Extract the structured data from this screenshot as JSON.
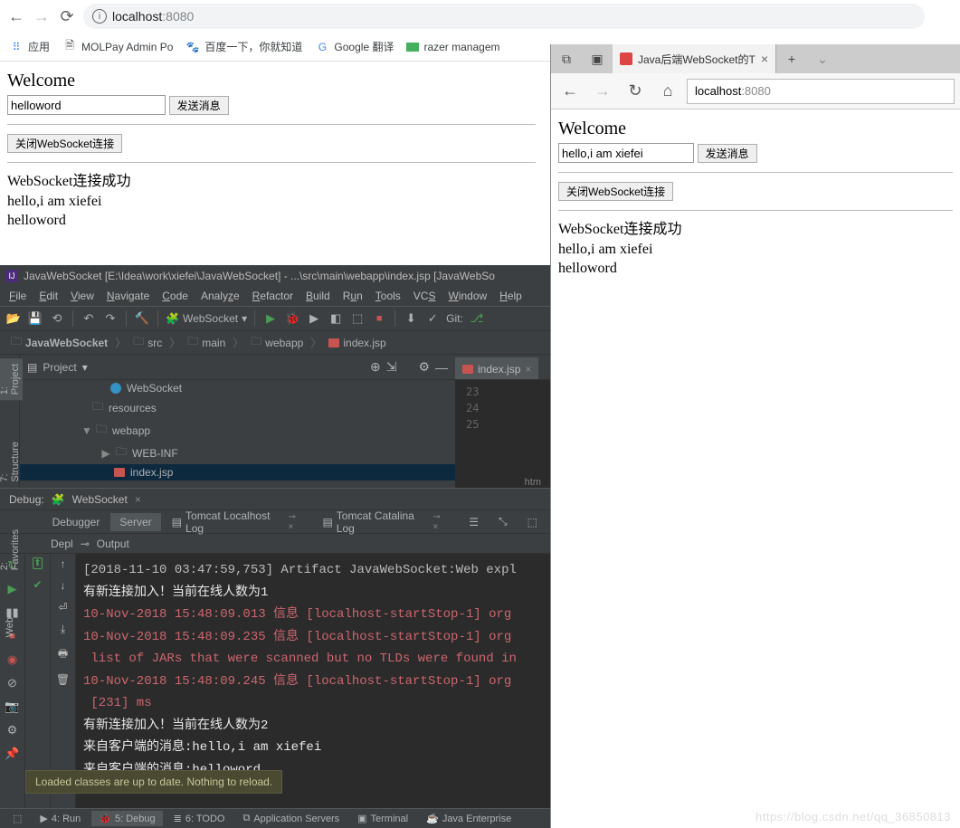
{
  "chrome": {
    "address_host": "localhost",
    "address_port": ":8080",
    "bookmarks": {
      "apps": "应用",
      "molpay": "MOLPay Admin Po",
      "baidu": "百度一下，你就知道",
      "gtrans": "Google 翻译",
      "razer": "razer managem"
    }
  },
  "page": {
    "welcome": "Welcome",
    "input_value": "helloword",
    "send_btn": "发送消息",
    "close_btn": "关闭WebSocket连接",
    "msg1": "WebSocket连接成功",
    "msg2": "hello,i am xiefei",
    "msg3": "helloword"
  },
  "ide": {
    "title": "JavaWebSocket [E:\\Idea\\work\\xiefei\\JavaWebSocket] - ...\\src\\main\\webapp\\index.jsp [JavaWebSo",
    "menu": {
      "file": "File",
      "edit": "Edit",
      "view": "View",
      "navigate": "Navigate",
      "code": "Code",
      "analyze": "Analyze",
      "refactor": "Refactor",
      "build": "Build",
      "run": "Run",
      "tools": "Tools",
      "vcs": "VCS",
      "window": "Window",
      "help": "Help"
    },
    "runcfg": "WebSocket",
    "git_label": "Git:",
    "crumbs": {
      "root": "JavaWebSocket",
      "src": "src",
      "main": "main",
      "webapp": "webapp",
      "file": "index.jsp"
    },
    "proj_label": "Project",
    "tree": {
      "websocket": "WebSocket",
      "resources": "resources",
      "webapp": "webapp",
      "webinf": "WEB-INF",
      "indexjsp": "index.jsp"
    },
    "editor_tab": "index.jsp",
    "editor_lines": {
      "l1": "23",
      "l2": "24",
      "l3": "25"
    },
    "htm_ind": "htm",
    "sidetabs": {
      "project": "1: Project",
      "structure": "7: Structure",
      "favorites": "2: Favorites",
      "web": "Web"
    },
    "debug": {
      "label": "Debug:",
      "config": "WebSocket",
      "t_debugger": "Debugger",
      "t_server": "Server",
      "t_tomcatlocal": "Tomcat Localhost Log",
      "t_tomcatcat": "Tomcat Catalina Log",
      "depl": "Depl",
      "output": "Output"
    },
    "console": {
      "l1": "[2018-11-10 03:47:59,753] Artifact JavaWebSocket:Web expl",
      "l2": "有新连接加入！当前在线人数为1",
      "l3": "10-Nov-2018 15:48:09.013 信息 [localhost-startStop-1] org",
      "l4": "10-Nov-2018 15:48:09.235 信息 [localhost-startStop-1] org",
      "l5": " list of JARs that were scanned but no TLDs were found in",
      "l6": "10-Nov-2018 15:48:09.245 信息 [localhost-startStop-1] org",
      "l7": " [231] ms",
      "l8": "有新连接加入！当前在线人数为2",
      "l9": "来自客户端的消息:hello,i am xiefei",
      "l10": "来自客户端的消息:helloword"
    },
    "tooltip": "Loaded classes are up to date. Nothing to reload.",
    "bottom": {
      "run": "4: Run",
      "debug": "5: Debug",
      "todo": "6: TODO",
      "appservers": "Application Servers",
      "terminal": "Terminal",
      "javaee": "Java Enterprise"
    }
  },
  "edge": {
    "tab_title": "Java后端WebSocket的T",
    "addr_host": "localhost",
    "addr_port": ":8080",
    "page": {
      "welcome": "Welcome",
      "input_value": "hello,i am xiefei",
      "send_btn": "发送消息",
      "close_btn": "关闭WebSocket连接",
      "msg1": "WebSocket连接成功",
      "msg2": "hello,i am xiefei",
      "msg3": "helloword"
    }
  },
  "watermark": "https://blog.csdn.net/qq_36850813"
}
